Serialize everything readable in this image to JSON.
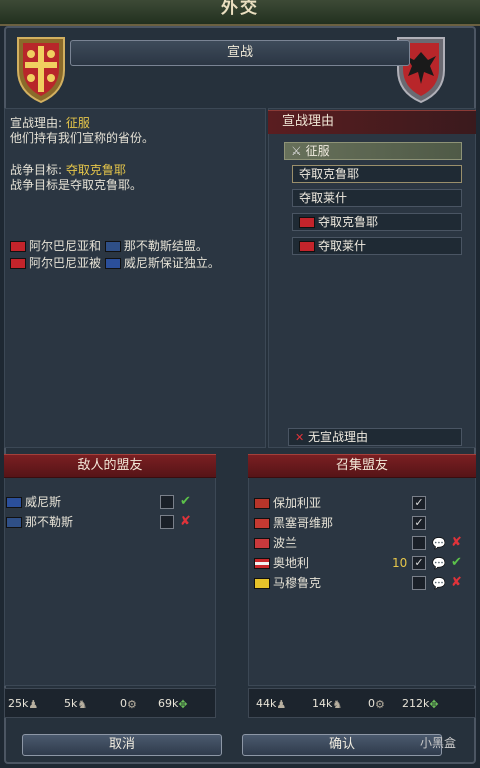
{
  "window": {
    "title": "外交"
  },
  "banner": {
    "label": "宣战"
  },
  "war_info": {
    "cb_prefix": "宣战理由: ",
    "cb_value": "征服",
    "cb_desc": "他们持有我们宣称的省份。",
    "goal_prefix": "战争目标: ",
    "goal_value": "夺取克鲁耶",
    "goal_desc": "战争目标是夺取克鲁耶。",
    "alliance_lines": [
      {
        "a": "阿尔巴尼亚和",
        "b": "那不勒斯结盟。"
      },
      {
        "a": "阿尔巴尼亚被",
        "b": "威尼斯保证独立。"
      }
    ]
  },
  "casus_belli": {
    "header": "宣战理由",
    "items": [
      {
        "label": "征服",
        "selected": true,
        "icon": "swords-icon"
      },
      {
        "label": "夺取克鲁耶",
        "selected": false,
        "icon": ""
      },
      {
        "label": "夺取莱什",
        "selected": false,
        "icon": ""
      },
      {
        "label": "夺取克鲁耶",
        "selected": false,
        "icon": "albania-flag-icon"
      },
      {
        "label": "夺取莱什",
        "selected": false,
        "icon": "albania-flag-icon"
      }
    ],
    "no_cb_label": "无宣战理由"
  },
  "enemy_allies": {
    "header": "敌人的盟友",
    "rows": [
      {
        "name": "威尼斯",
        "status": "✔"
      },
      {
        "name": "那不勒斯",
        "status": "✘"
      }
    ],
    "stats": {
      "infantry": "25k",
      "cavalry": "5k",
      "artillery": "0",
      "total": "69k"
    }
  },
  "call_allies": {
    "header": "召集盟友",
    "rows": [
      {
        "name": "保加利亚",
        "checked": "✓",
        "num": "",
        "status": ""
      },
      {
        "name": "黑塞哥维那",
        "checked": "✓",
        "num": "",
        "status": ""
      },
      {
        "name": "波兰",
        "checked": "",
        "num": "",
        "status": "✘"
      },
      {
        "name": "奥地利",
        "checked": "✓",
        "num": "10",
        "status": "✔"
      },
      {
        "name": "马穆鲁克",
        "checked": "",
        "num": "",
        "status": "✘"
      }
    ],
    "stats": {
      "infantry": "44k",
      "cavalry": "14k",
      "artillery": "0",
      "total": "212k"
    }
  },
  "buttons": {
    "cancel": "取消",
    "confirm": "确认"
  },
  "watermark": "小黑盒"
}
